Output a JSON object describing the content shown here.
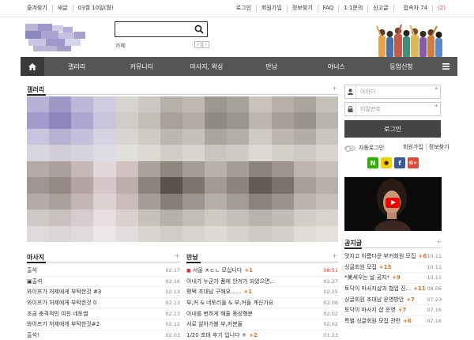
{
  "topbar": {
    "left": [
      "즐겨찾기",
      "새글",
      "03월 10일(월)"
    ],
    "right": [
      "로그인",
      "회원가입",
      "정보찾기",
      "FAQ",
      "1:1문의",
      "신고글"
    ],
    "visitors_label": "접속자 74",
    "visitors_count": "(2)"
  },
  "header": {
    "search_sub": "카페",
    "prev": "‹",
    "next": "›"
  },
  "nav": {
    "items": [
      "갤러리",
      "커뮤니티",
      "마사지, 왁싱",
      "만남",
      "야너스",
      "등업신청"
    ]
  },
  "gallery": {
    "title": "갤러리",
    "more": "+"
  },
  "login": {
    "id_placeholder": "아이디",
    "pw_placeholder": "비밀번호",
    "required_mark": "*",
    "button": "로그인",
    "auto_login": "자동로그인",
    "join": "회원가입",
    "find": "정보찾기",
    "social": [
      {
        "label": "N",
        "color": "#2db400"
      },
      {
        "label": "●",
        "color": "#f5d000"
      },
      {
        "label": "f",
        "color": "#3b5998"
      },
      {
        "label": "G+",
        "color": "#dd4b39"
      }
    ]
  },
  "massage": {
    "title": "마사지",
    "more": "+",
    "rows": [
      {
        "title": "출석",
        "date": "02.17"
      },
      {
        "title": "▣출석",
        "date": "02.16"
      },
      {
        "title": "와이프가 처제에게 부탁한것 #3",
        "date": "02.13"
      },
      {
        "title": "와이프가 처제에게 부탁한것 0",
        "date": "02.13"
      },
      {
        "title": "조금 충격적인 여친 네토썰",
        "date": "02.13"
      },
      {
        "title": "와이프가 처제에게 부탁한것#2",
        "date": "02.12"
      },
      {
        "title": "출석!",
        "date": "02.03"
      }
    ]
  },
  "meet": {
    "title": "만남",
    "more": "+",
    "rows": [
      {
        "title": "서울 ㅊㄷㄴ 모십니다",
        "comments": "+1",
        "date": "08:51",
        "new": true
      },
      {
        "title": "아내가 누군가 품에 안겨가 되었으면...",
        "comments": "",
        "date": "02.27"
      },
      {
        "title": "평택 초대남 구해요......",
        "comments": "+1",
        "date": "02.25"
      },
      {
        "title": "부,커 & 네토리들 & 부,커들 계신가요",
        "comments": "",
        "date": "02.06"
      },
      {
        "title": "아내를 변하게 해줄 동성형분",
        "comments": "",
        "date": "02.02"
      },
      {
        "title": "서로 알아가볼 부,커분들",
        "comments": "",
        "date": "02.02"
      },
      {
        "title": "1/20 초대 후기 입니다 ㅎ",
        "comments": "+2",
        "date": "01.23"
      }
    ]
  },
  "notice": {
    "title": "공지글",
    "more": "+",
    "rows": [
      {
        "title": "멋지고 아름다운 부커회원 모집",
        "comments": "+6",
        "date": "10.11"
      },
      {
        "title": "싱글회원 모집",
        "comments": "+15",
        "date": "10.11"
      },
      {
        "title": "*美세우는 날 공지*",
        "comments": "+9",
        "date": "10.11"
      },
      {
        "title": "토닥이 마사지샵과 협업 진...",
        "comments": "+11",
        "date": "08.06"
      },
      {
        "title": "싱글회원 초대남 운영방안",
        "comments": "+7",
        "date": "07.23"
      },
      {
        "title": "토닥이 마사지 샵 운영",
        "comments": "+7",
        "date": "07.16"
      },
      {
        "title": "특별 싱글회원 모집 관련",
        "comments": "+6",
        "date": "07.16"
      }
    ]
  }
}
